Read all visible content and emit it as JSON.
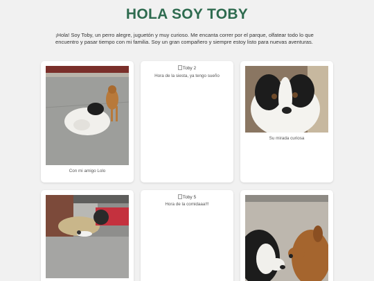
{
  "header": {
    "title": "HOLA SOY TOBY",
    "intro": "¡Hola! Soy Toby, un perro alegre, juguetón y muy curioso. Me encanta correr por el parque, olfatear todo lo que encuentro y pasar tiempo con mi familia. Soy un gran compañero y siempre estoy listo para nuevas aventuras."
  },
  "gallery": {
    "cards": [
      {
        "caption": "Con mi amigo Lolo",
        "image": "photo-toby-with-dog-lolo"
      },
      {
        "alt": "Toby 2",
        "caption": "Hora de la siesta, ya tengo sueño",
        "image": "broken-image"
      },
      {
        "caption": "Su mirada curiosa",
        "image": "photo-toby-closeup"
      },
      {
        "caption": "",
        "image": "photo-toby-in-barn"
      },
      {
        "alt": "Toby 5",
        "caption": "Hora de la comidaaa!!!",
        "image": "broken-image"
      },
      {
        "caption": "",
        "image": "photo-toby-and-dog"
      }
    ]
  },
  "colors": {
    "title": "#2e6b4f",
    "background": "#f1f1f1",
    "card": "#ffffff"
  }
}
